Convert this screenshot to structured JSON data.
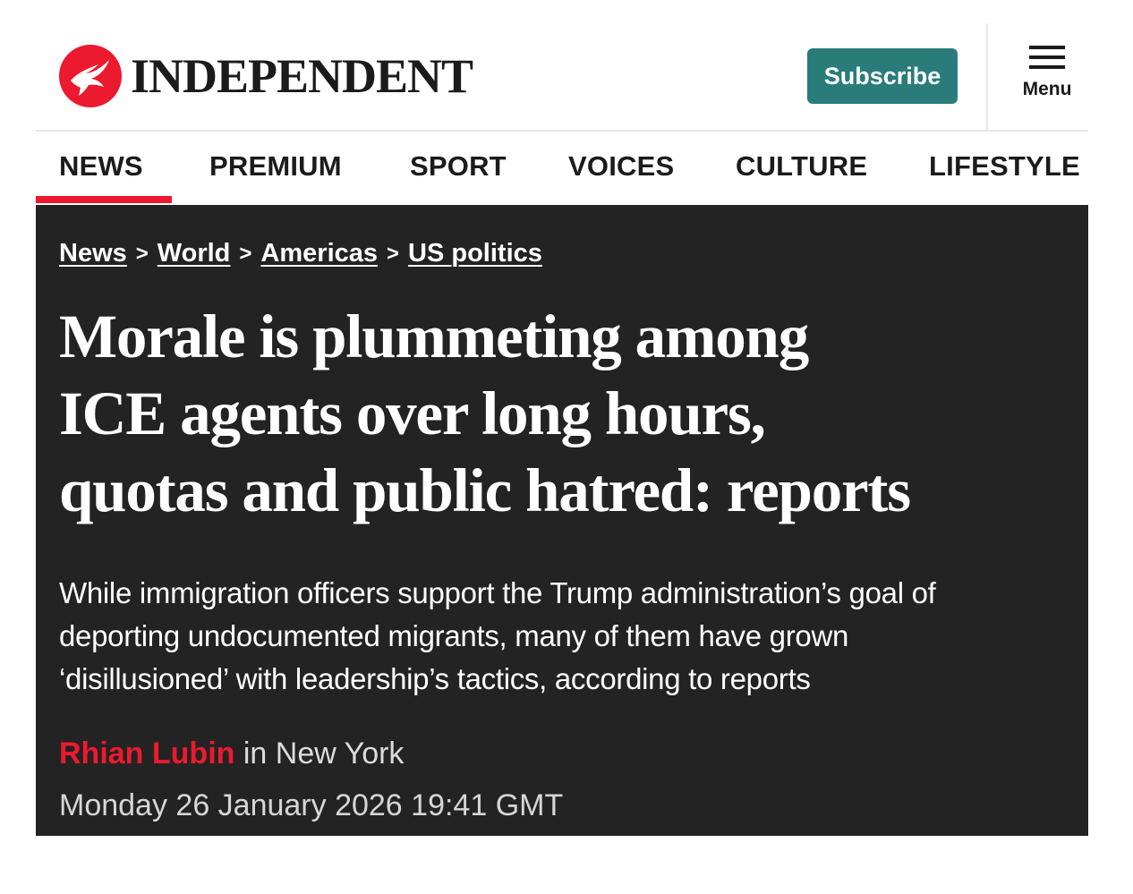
{
  "header": {
    "logo_text": "INDEPENDENT",
    "subscribe_label": "Subscribe",
    "menu_label": "Menu"
  },
  "nav": {
    "items": [
      "NEWS",
      "PREMIUM",
      "SPORT",
      "VOICES",
      "CULTURE",
      "LIFESTYLE"
    ],
    "active": "NEWS"
  },
  "breadcrumb": {
    "items": [
      "News",
      "World",
      "Americas",
      "US politics"
    ],
    "separator": ">"
  },
  "article": {
    "headline_lines": [
      "Morale is plummeting among",
      "ICE agents over long hours,",
      "quotas and public hatred: reports"
    ],
    "standfirst_lines": [
      "While immigration officers support the Trump administration’s goal of",
      "deporting undocumented migrants, many of them have grown",
      "‘disillusioned’ with leadership’s tactics, according to reports"
    ],
    "author": "Rhian Lubin",
    "location": "in New York",
    "date": "Monday 26 January 2026 19:41 GMT"
  },
  "colors": {
    "brand_red": "#ec1a2e",
    "subscribe_teal": "#2a7c7b",
    "hero_background": "#232323"
  },
  "icons": {
    "logo": "eagle-logo-icon",
    "menu": "hamburger-menu-icon"
  }
}
